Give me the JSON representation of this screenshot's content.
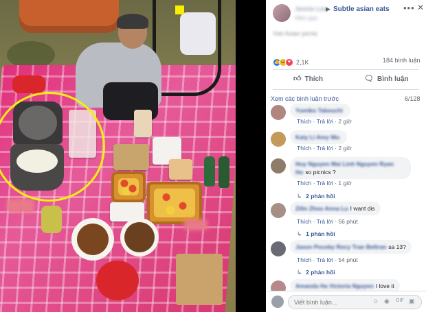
{
  "post": {
    "author_blurred": "Jennie Lee",
    "arrow": "▶",
    "group": "Subtle asian eats",
    "time_blurred": "Hôm qua",
    "text_blurred": "Viet Asian picnic",
    "reaction_count": "2,1K",
    "comment_count": "184 bình luận",
    "more_icon": "•••",
    "close_icon": "✕"
  },
  "actions": {
    "like": "Thích",
    "comment": "Bình luận"
  },
  "comments_header": {
    "prev": "Xem các bình luận trước",
    "pages": "6/128"
  },
  "comments": [
    {
      "name": "Yumiko Takeuchi",
      "text": "",
      "like": "Thích",
      "reply": "Trả lời",
      "time": "2 giờ"
    },
    {
      "name": "Katy Li Amy Wu",
      "text": "",
      "like": "Thích",
      "reply": "Trả lời",
      "time": "2 giờ"
    },
    {
      "name": "Huy Nguyen Mai Linh Nguyen Ryan Ho",
      "text": "so picnics ?",
      "like": "Thích",
      "reply": "Trả lời",
      "time": "1 giờ",
      "replies": "2 phản hồi"
    },
    {
      "name": "Zilin Zhou Anna Lu",
      "text": "I want dis",
      "like": "Thích",
      "reply": "Trả lời",
      "time": "56 phút",
      "replies": "1 phản hồi"
    },
    {
      "name": "Jason Pecoby Rocy Tran Beltran",
      "text": "sa 13?",
      "like": "Thích",
      "reply": "Trả lời",
      "time": "54 phút",
      "replies": "2 phản hồi"
    },
    {
      "name": "Amanda Ha Victoria Nguyen",
      "text": "I love it"
    }
  ],
  "composer": {
    "placeholder": "Viết bình luận..."
  },
  "colors": {
    "link": "#385898",
    "highlight_circle": "#f4ef10",
    "blanket": "#e0307a"
  }
}
